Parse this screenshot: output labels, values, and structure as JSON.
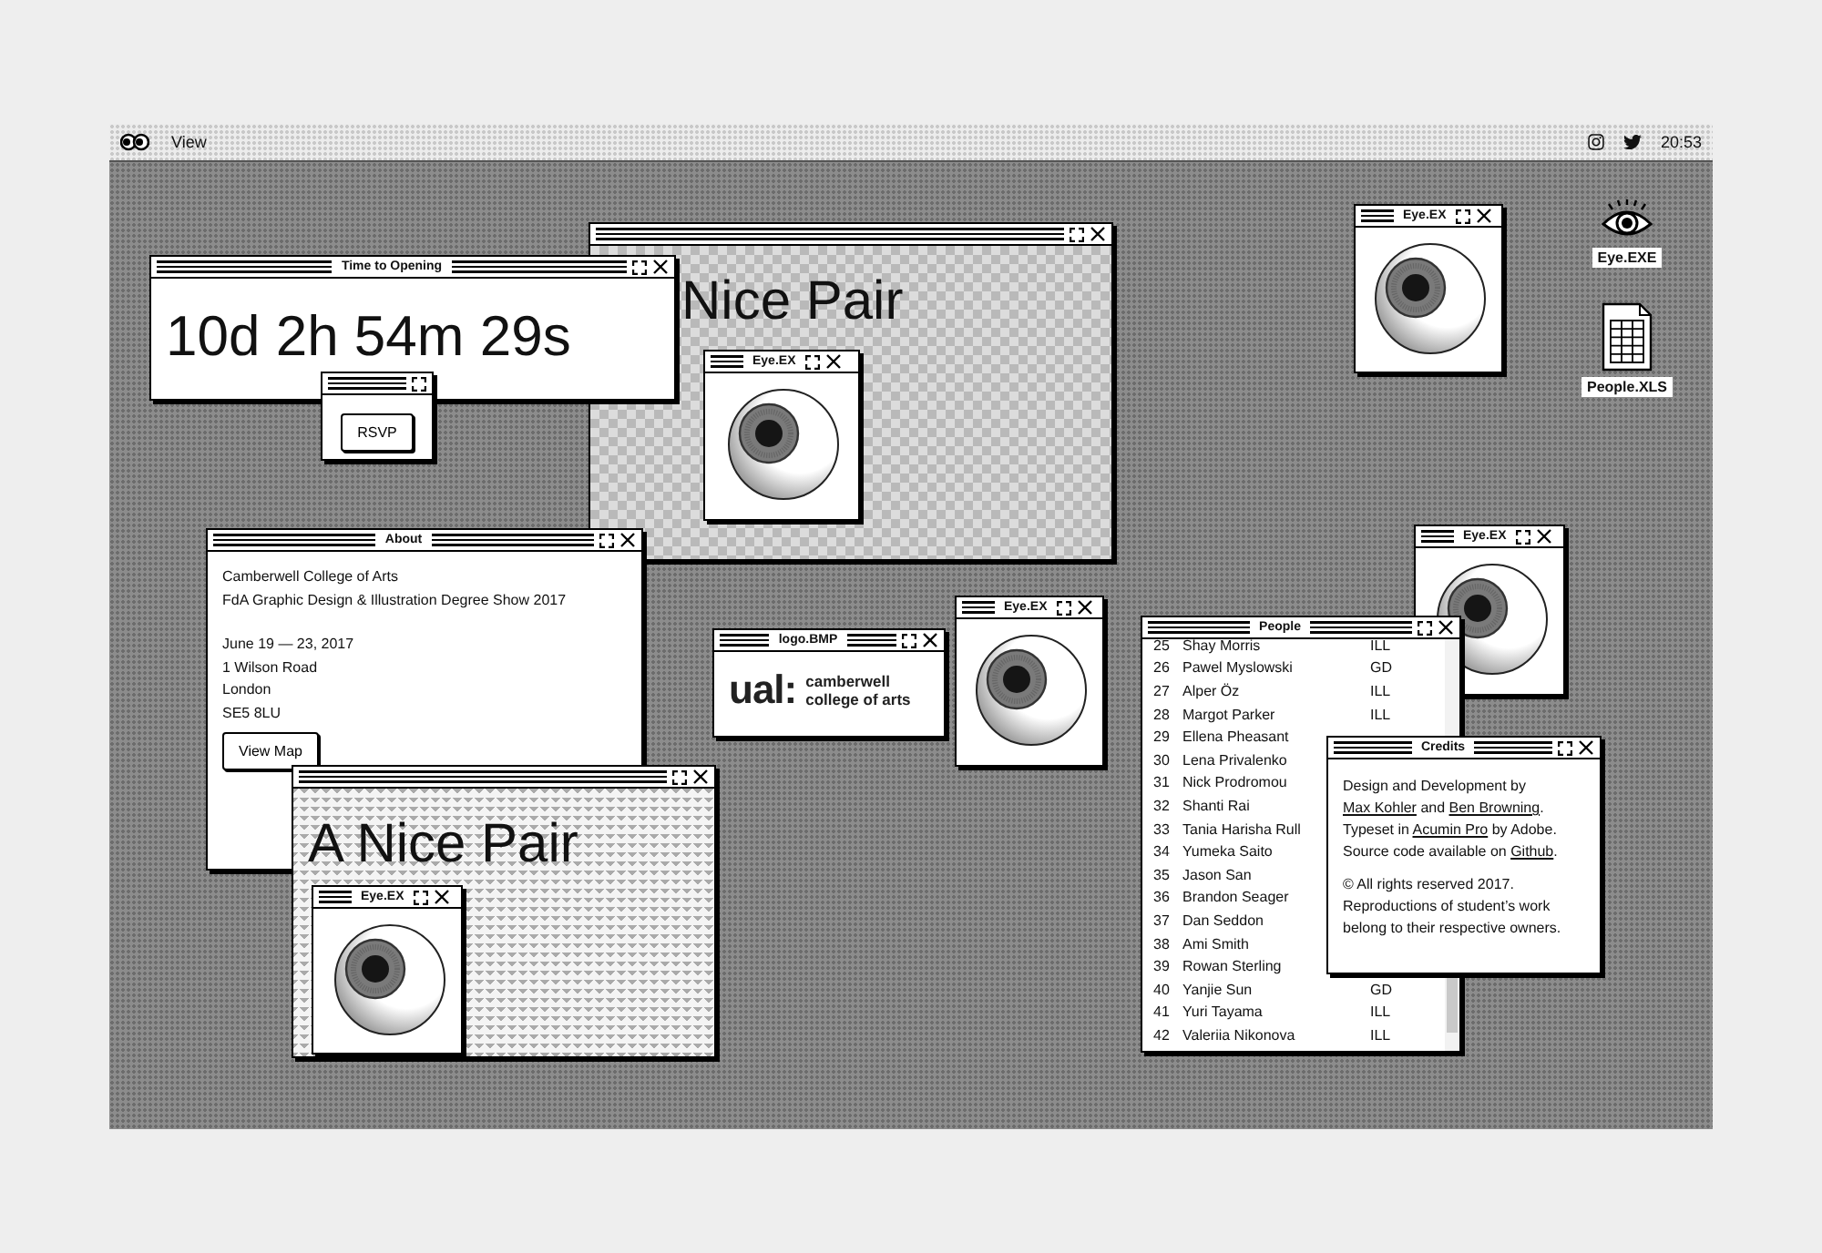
{
  "menu_bar": {
    "menus": [
      "View"
    ],
    "clock": "20:53"
  },
  "desktop_icons": [
    {
      "kind": "eye",
      "label": "Eye.EXE"
    },
    {
      "kind": "spreadsheet",
      "label": "People.XLS"
    }
  ],
  "windows": [
    {
      "kind": "checkered",
      "closable": true,
      "heading": "Nice Pair"
    },
    {
      "kind": "eye",
      "title": "Eye.EX",
      "closable": true
    },
    {
      "kind": "countdown",
      "title": "Time to Opening",
      "closable": true,
      "value": "10d 2h 54m 29s"
    },
    {
      "kind": "button",
      "closable": false,
      "button": "RSVP"
    },
    {
      "kind": "eye",
      "title": "Eye.EX",
      "closable": true
    },
    {
      "kind": "about",
      "title": "About",
      "closable": true,
      "paragraphs": [
        [
          "Camberwell College of Arts",
          "FdA Graphic Design & Illustration Degree Show 2017"
        ],
        [
          "June 19 — 23, 2017",
          "1 Wilson Road",
          "London",
          "SE5 8LU"
        ]
      ],
      "button": "View Map"
    },
    {
      "kind": "zigzag",
      "closable": true,
      "heading": "A Nice Pair"
    },
    {
      "kind": "eye",
      "title": "Eye.EX",
      "closable": true
    },
    {
      "kind": "logo",
      "title": "logo.BMP",
      "closable": true,
      "mark": "ual:",
      "lines": [
        "camberwell",
        "college of arts"
      ]
    },
    {
      "kind": "eye",
      "title": "Eye.EX",
      "closable": true
    },
    {
      "kind": "eye",
      "title": "Eye.EX",
      "closable": true
    },
    {
      "kind": "people",
      "title": "People",
      "closable": true,
      "rows": [
        {
          "number": "25",
          "name": "Shay Morris",
          "group": "ILL"
        },
        {
          "number": "26",
          "name": "Pawel Myslowski",
          "group": "GD"
        },
        {
          "number": "27",
          "name": "Alper Öz",
          "group": "ILL"
        },
        {
          "number": "28",
          "name": "Margot Parker",
          "group": "ILL"
        },
        {
          "number": "29",
          "name": "Ellena Pheasant"
        },
        {
          "number": "30",
          "name": "Lena Privalenko"
        },
        {
          "number": "31",
          "name": "Nick Prodromou"
        },
        {
          "number": "32",
          "name": "Shanti Rai"
        },
        {
          "number": "33",
          "name": "Tania Harisha Rull"
        },
        {
          "number": "34",
          "name": "Yumeka Saito"
        },
        {
          "number": "35",
          "name": "Jason San"
        },
        {
          "number": "36",
          "name": "Brandon Seager"
        },
        {
          "number": "37",
          "name": "Dan Seddon"
        },
        {
          "number": "38",
          "name": "Ami Smith"
        },
        {
          "number": "39",
          "name": "Rowan Sterling"
        },
        {
          "number": "40",
          "name": "Yanjie Sun",
          "group": "GD"
        },
        {
          "number": "41",
          "name": "Yuri Tayama",
          "group": "ILL"
        },
        {
          "number": "42",
          "name": "Valeriia Nikonova",
          "group": "ILL"
        }
      ]
    },
    {
      "kind": "credits",
      "title": "Credits",
      "closable": true,
      "paragraphs": [
        [
          {
            "text": "Design and Development by "
          },
          {
            "text": "Max Kohler",
            "link": true
          },
          {
            "text": " and "
          },
          {
            "text": "Ben Browning",
            "link": true
          },
          {
            "text": ". Typeset in "
          },
          {
            "text": "Acumin Pro",
            "link": true
          },
          {
            "text": " by Adobe. Source code available on "
          },
          {
            "text": "Github",
            "link": true
          },
          {
            "text": "."
          }
        ],
        [
          {
            "text": "© All rights reserved 2017. Reproductions of student’s work belong to their respective owners."
          }
        ]
      ]
    }
  ]
}
